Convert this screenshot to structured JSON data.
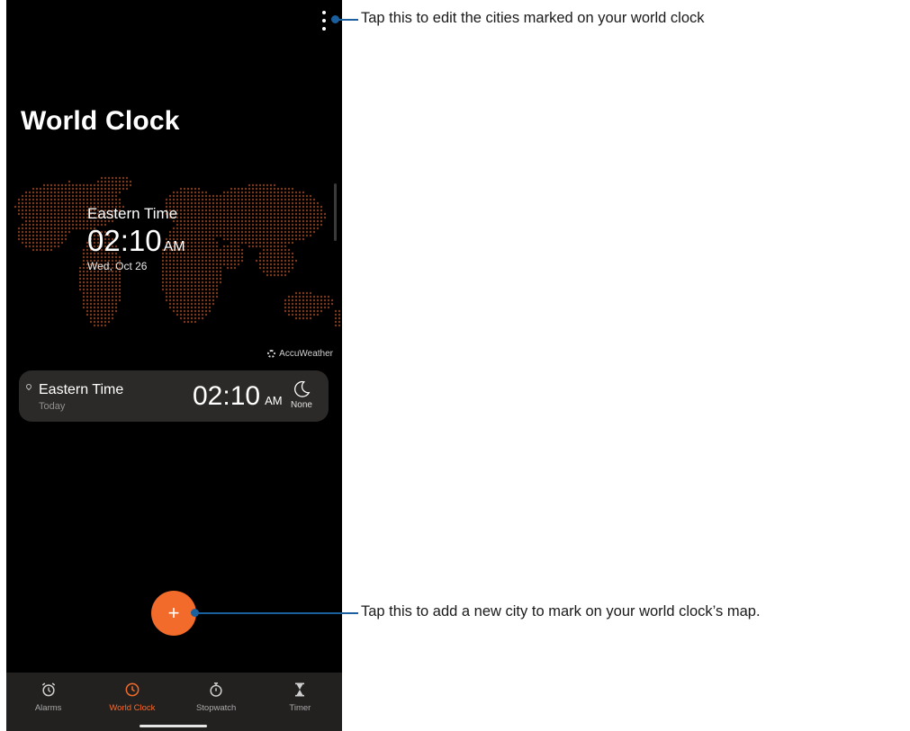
{
  "header": {
    "title": "World Clock"
  },
  "map": {
    "zone_name": "Eastern Time",
    "time": "02:10",
    "ampm": "AM",
    "date": "Wed, Oct 26",
    "attribution": "AccuWeather"
  },
  "city_card": {
    "city": "Eastern Time",
    "day": "Today",
    "time": "02:10",
    "ampm": "AM",
    "weather_label": "None",
    "weather_icon": "moon-icon"
  },
  "fab": {
    "label": "+"
  },
  "nav": {
    "items": [
      {
        "label": "Alarms",
        "icon": "alarm-icon",
        "active": false
      },
      {
        "label": "World Clock",
        "icon": "clock-icon",
        "active": true
      },
      {
        "label": "Stopwatch",
        "icon": "stopwatch-icon",
        "active": false
      },
      {
        "label": "Timer",
        "icon": "hourglass-icon",
        "active": false
      }
    ]
  },
  "callouts": {
    "menu": "Tap this to edit the cities marked on your world clock",
    "add": "Tap this to add a new city to mark on your world clock’s map."
  },
  "colors": {
    "accent": "#f26b2a",
    "callout": "#1a5f9e",
    "map_dots": "#7a3a1c",
    "card_bg": "#2c2a28"
  }
}
